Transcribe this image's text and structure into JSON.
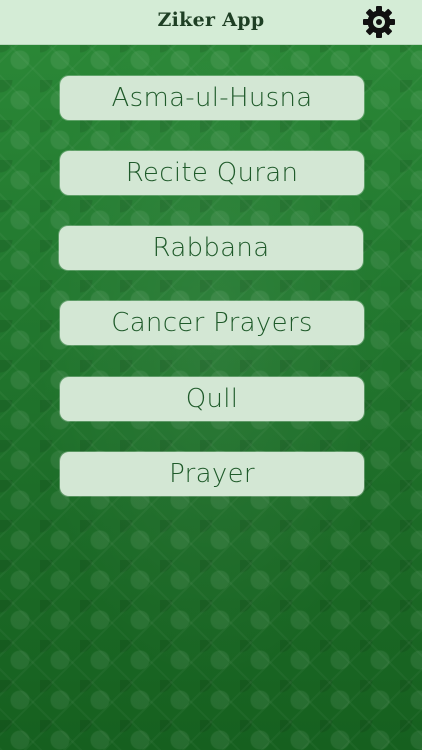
{
  "header": {
    "title": "Ziker App",
    "settings_icon": "gear-icon"
  },
  "menu": {
    "items": [
      {
        "label": "Asma-ul-Husna"
      },
      {
        "label": "Recite Quran"
      },
      {
        "label": "Rabbana"
      },
      {
        "label": "Cancer Prayers"
      },
      {
        "label": "Qull"
      },
      {
        "label": "Prayer"
      }
    ]
  },
  "colors": {
    "header_bg": "#d4ecd6",
    "background_green": "#237a30",
    "button_bg": "#d3e7d4",
    "button_text": "#1f5a2a",
    "title_text": "#1e3f24"
  }
}
